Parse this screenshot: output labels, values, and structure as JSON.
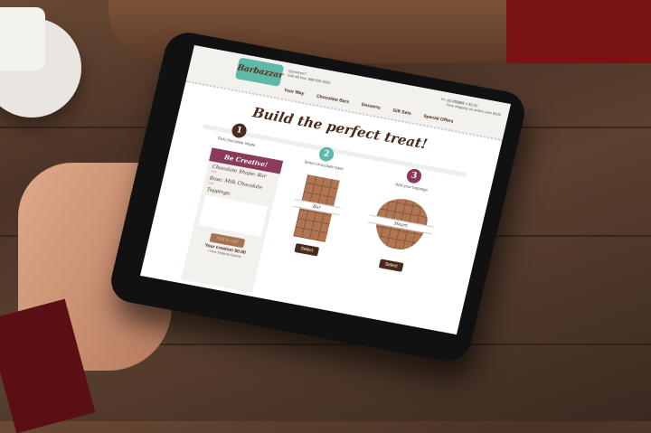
{
  "site": {
    "logo": "Barbazzar",
    "questions": "Questions?",
    "phone": "Call toll free: 888-555-5555",
    "account": "MY ACCOUNT",
    "cart": "ITEMS: 0  $0.00",
    "shipping_note": "Free shipping on orders over $100"
  },
  "nav": [
    "Your Way",
    "Chocolate Bars",
    "Desserts",
    "Gift Sets",
    "Special Offers"
  ],
  "title": "Build the perfect treat!",
  "steps": [
    {
      "n": "1",
      "label": "Pick chocolate shape",
      "color": "#4a2a1a"
    },
    {
      "n": "2",
      "label": "Select chocolate base",
      "color": "#5fb9a8"
    },
    {
      "n": "3",
      "label": "Add your toppings",
      "color": "#8a3a5a"
    }
  ],
  "sidebar": {
    "heading": "Be Creative!",
    "shape": "Chocolate Shape: Bar",
    "base": "Base: Milk Chocolate",
    "edit": "Edit",
    "toppings": "Toppings:",
    "add_to_cart": "Add to cart",
    "total": "Your creation  $0.00",
    "shipping": "+ View Shipping Options"
  },
  "options": [
    {
      "label": "Bar",
      "select": "Select"
    },
    {
      "label": "Heart",
      "select": "Select"
    }
  ]
}
